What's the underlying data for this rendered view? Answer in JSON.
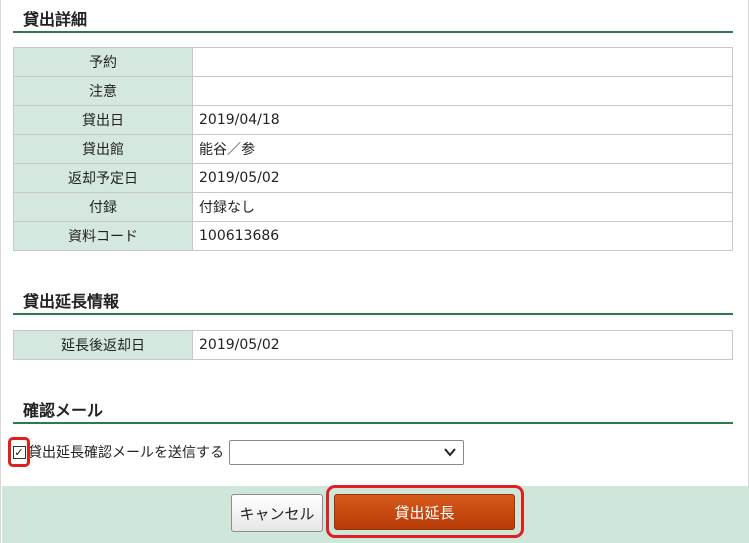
{
  "loan_detail": {
    "title": "貸出詳細",
    "rows": [
      {
        "label": "予約",
        "value": ""
      },
      {
        "label": "注意",
        "value": ""
      },
      {
        "label": "貸出日",
        "value": "2019/04/18"
      },
      {
        "label": "貸出館",
        "value": "能谷／参"
      },
      {
        "label": "返却予定日",
        "value": "2019/05/02"
      },
      {
        "label": "付録",
        "value": "付録なし"
      },
      {
        "label": "資料コード",
        "value": "100613686"
      }
    ]
  },
  "extension_info": {
    "title": "貸出延長情報",
    "rows": [
      {
        "label": "延長後返却日",
        "value": "2019/05/02"
      }
    ]
  },
  "confirm_mail": {
    "title": "確認メール",
    "checkbox_label": "貸出延長確認メールを送信する",
    "checked": true,
    "select_value": ""
  },
  "actions": {
    "cancel_label": "キャンセル",
    "extend_label": "貸出延長"
  },
  "colors": {
    "header_cell_bg": "#d4e8df",
    "rule": "#2e7a4e",
    "footer_bg": "#cfe6da",
    "primary_button": "#c84a0f",
    "highlight": "#e01f1f"
  }
}
